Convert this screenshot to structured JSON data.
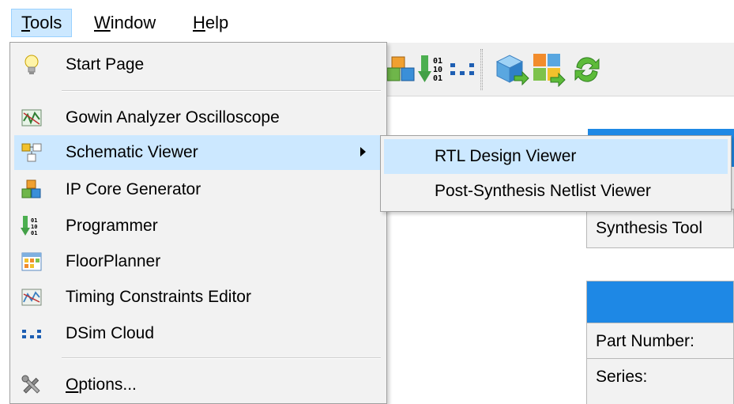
{
  "menubar": {
    "items": [
      {
        "prefix": "",
        "mnemonic": "T",
        "rest": "ools",
        "active": true
      },
      {
        "prefix": "",
        "mnemonic": "W",
        "rest": "indow",
        "active": false
      },
      {
        "prefix": "",
        "mnemonic": "H",
        "rest": "elp",
        "active": false
      }
    ]
  },
  "tools_menu": {
    "start_page": "Start Page",
    "analyzer": "Gowin Analyzer Oscilloscope",
    "schematic_viewer": "Schematic Viewer",
    "ip_core": "IP Core Generator",
    "programmer": "Programmer",
    "floorplanner": "FloorPlanner",
    "timing": "Timing Constraints Editor",
    "dsim": "DSim Cloud",
    "options_mnemonic": "O",
    "options_rest": "ptions..."
  },
  "schematic_submenu": {
    "rtl": "RTL Design Viewer",
    "post_synthesis": "Post-Synthesis Netlist Viewer"
  },
  "background": {
    "summary_row": "Synthesis Tool",
    "device_rows": [
      "Part Number:",
      "Series:"
    ]
  },
  "colors": {
    "highlight": "#cce8ff",
    "menu_bg": "#f2f2f2",
    "header_blue": "#1e88e5"
  }
}
